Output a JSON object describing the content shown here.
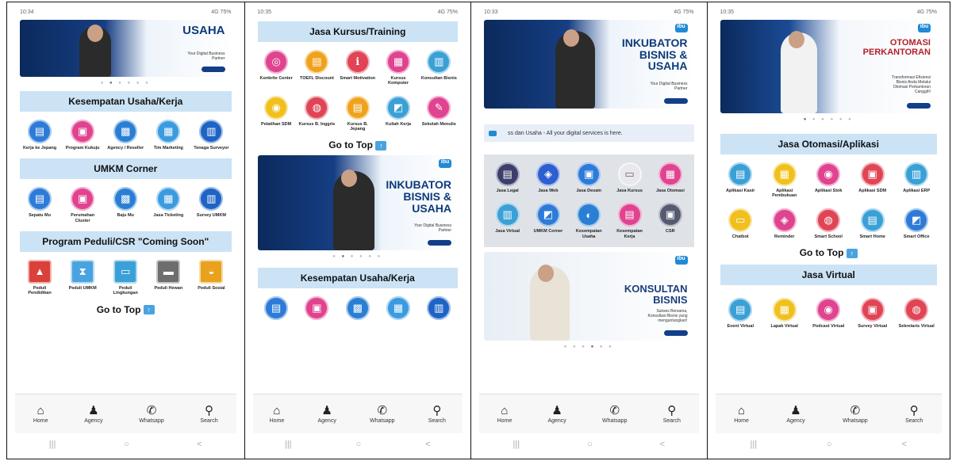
{
  "screens": [
    {
      "statusbar": {
        "time": "10:34",
        "right": "4G 75%"
      },
      "banner": {
        "heading": "USAHA",
        "sub": "Your Digital Business Partner"
      },
      "sections": [
        {
          "title": "Kesempatan Usaha/Kerja",
          "items": [
            {
              "label": "Kerja ke Jepang",
              "color": "#2d7bd8",
              "glyph": "▤"
            },
            {
              "label": "Program Kukuju",
              "color": "#e0438f",
              "glyph": "▣"
            },
            {
              "label": "Agency / Reseller",
              "color": "#2a7fd4",
              "glyph": "▩"
            },
            {
              "label": "Tim Marketing",
              "color": "#3b9be0",
              "glyph": "▦"
            },
            {
              "label": "Tenaga Surveyor",
              "color": "#1e63c6",
              "glyph": "▥"
            }
          ]
        },
        {
          "title": "UMKM Corner",
          "items": [
            {
              "label": "Sepatu Mu",
              "color": "#2d7bd8",
              "glyph": "▤"
            },
            {
              "label": "Perumahan Cluster",
              "color": "#e0438f",
              "glyph": "▣"
            },
            {
              "label": "Baju Mu",
              "color": "#2a7fd4",
              "glyph": "▩"
            },
            {
              "label": "Jasa Ticketing",
              "color": "#3b9be0",
              "glyph": "▦"
            },
            {
              "label": "Survey UMKM",
              "color": "#1e63c6",
              "glyph": "▥"
            }
          ]
        },
        {
          "title": "Program Peduli/CSR \"Coming Soon\"",
          "items": [
            {
              "label": "Peduli Pendidikan",
              "color": "#d9413a",
              "glyph": "▲"
            },
            {
              "label": "Peduli UMKM",
              "color": "#4aa3df",
              "glyph": "⧗"
            },
            {
              "label": "Peduli Lingkungan",
              "color": "#3ba0d7",
              "glyph": "▭"
            },
            {
              "label": "Peduli Hewan",
              "color": "#6e6e6e",
              "glyph": "▬"
            },
            {
              "label": "Peduli Sosial",
              "color": "#e8a21d",
              "glyph": "◒"
            }
          ]
        }
      ],
      "gotop": "Go to Top"
    },
    {
      "statusbar": {
        "time": "10:35",
        "right": "4G 75%"
      },
      "top_section": {
        "title": "Jasa Kursus/Training",
        "items": [
          {
            "label": "Konkrite Center",
            "color": "#e0438f",
            "glyph": "◎"
          },
          {
            "label": "TOEFL Discount",
            "color": "#f0a21d",
            "glyph": "▤"
          },
          {
            "label": "Smart Motivation",
            "color": "#e04455",
            "glyph": "ℹ"
          },
          {
            "label": "Kursus Komputer",
            "color": "#e0438f",
            "glyph": "▦"
          },
          {
            "label": "Konsultan Bisnis",
            "color": "#3aa0d6",
            "glyph": "▥"
          },
          {
            "label": "Pelatihan SDM",
            "color": "#f0c01d",
            "glyph": "◉"
          },
          {
            "label": "Kursus B. Inggris",
            "color": "#e04455",
            "glyph": "◍"
          },
          {
            "label": "Kursus B. Jepang",
            "color": "#f0a21d",
            "glyph": "▤"
          },
          {
            "label": "Kuliah Kerja",
            "color": "#3aa0d6",
            "glyph": "◩"
          },
          {
            "label": "Sekolah Menulis",
            "color": "#e0438f",
            "glyph": "✎"
          }
        ]
      },
      "gotop": "Go to Top",
      "banner": {
        "heading": "INKUBATOR BISNIS & USAHA",
        "sub": "Your Digital Business Partner"
      },
      "section2": {
        "title": "Kesempatan Usaha/Kerja"
      }
    },
    {
      "statusbar": {
        "time": "10:33",
        "right": "4G 75%"
      },
      "banner": {
        "heading": "INKUBATOR BISNIS & USAHA",
        "sub": "Your Digital Business Partner"
      },
      "ticker": "ss dan Usaha - All your digital services is here.",
      "items": [
        {
          "label": "Jasa Legal",
          "color": "#3c3f6b",
          "glyph": "▤"
        },
        {
          "label": "Jasa Web",
          "color": "#2d5fd0",
          "glyph": "◈"
        },
        {
          "label": "Jasa Desain",
          "color": "#2d7bd8",
          "glyph": "▣"
        },
        {
          "label": "Jasa Kursus",
          "color": "#e8e8ee",
          "glyph": "▭"
        },
        {
          "label": "Jasa Otomasi",
          "color": "#e0438f",
          "glyph": "▦"
        },
        {
          "label": "Jasa Virtual",
          "color": "#3aa0d6",
          "glyph": "▥"
        },
        {
          "label": "UMKM Corner",
          "color": "#2d7bd8",
          "glyph": "◩"
        },
        {
          "label": "Kesempatan Usaha",
          "color": "#2a7fd4",
          "glyph": "◐"
        },
        {
          "label": "Kesempatan Kerja",
          "color": "#e0438f",
          "glyph": "▤"
        },
        {
          "label": "CSR",
          "color": "#555a70",
          "glyph": "▣"
        }
      ],
      "banner2": {
        "heading": "KONSULTAN BISNIS",
        "sub": "Sukses Bersama, Konsultasi Bisnis yang menguntungkan!"
      }
    },
    {
      "statusbar": {
        "time": "10:35",
        "right": "4G 75%"
      },
      "banner": {
        "heading": "OTOMASI PERKANTORAN",
        "sub": "Transformasi Efisiensi Bisnis Anda Melalui Otomasi Perkantoran Canggih!"
      },
      "section1": {
        "title": "Jasa Otomasi/Aplikasi",
        "items": [
          {
            "label": "Aplikasi Kasir",
            "color": "#3aa0d6",
            "glyph": "▤"
          },
          {
            "label": "Aplikasi Pembukuan",
            "color": "#f0c01d",
            "glyph": "▦"
          },
          {
            "label": "Aplikasi Stok",
            "color": "#e0438f",
            "glyph": "◉"
          },
          {
            "label": "Aplikasi SDM",
            "color": "#e04455",
            "glyph": "▣"
          },
          {
            "label": "Aplikasi ERP",
            "color": "#3aa0d6",
            "glyph": "▥"
          },
          {
            "label": "Chatbot",
            "color": "#f0c01d",
            "glyph": "▭"
          },
          {
            "label": "Reminder",
            "color": "#e0438f",
            "glyph": "◈"
          },
          {
            "label": "Smart School",
            "color": "#e04455",
            "glyph": "◍"
          },
          {
            "label": "Smart Home",
            "color": "#3aa0d6",
            "glyph": "▤"
          },
          {
            "label": "Smart Office",
            "color": "#2d7bd8",
            "glyph": "◩"
          }
        ]
      },
      "gotop": "Go to Top",
      "section2": {
        "title": "Jasa Virtual",
        "items": [
          {
            "label": "Event Virtual",
            "color": "#3aa0d6",
            "glyph": "▤"
          },
          {
            "label": "Lapak Virtual",
            "color": "#f0c01d",
            "glyph": "▦"
          },
          {
            "label": "Podcast Virtual",
            "color": "#e0438f",
            "glyph": "◉"
          },
          {
            "label": "Survey Virtual",
            "color": "#e04455",
            "glyph": "▣"
          },
          {
            "label": "Sekretaris Virtual",
            "color": "#e04455",
            "glyph": "◍"
          }
        ]
      }
    }
  ],
  "nav": [
    {
      "label": "Home",
      "glyph": "⌂"
    },
    {
      "label": "Agency",
      "glyph": "♟"
    },
    {
      "label": "Whatsapp",
      "glyph": "✆"
    },
    {
      "label": "Search",
      "glyph": "⚲"
    }
  ],
  "sysbar": [
    "|||",
    "○",
    "<"
  ]
}
